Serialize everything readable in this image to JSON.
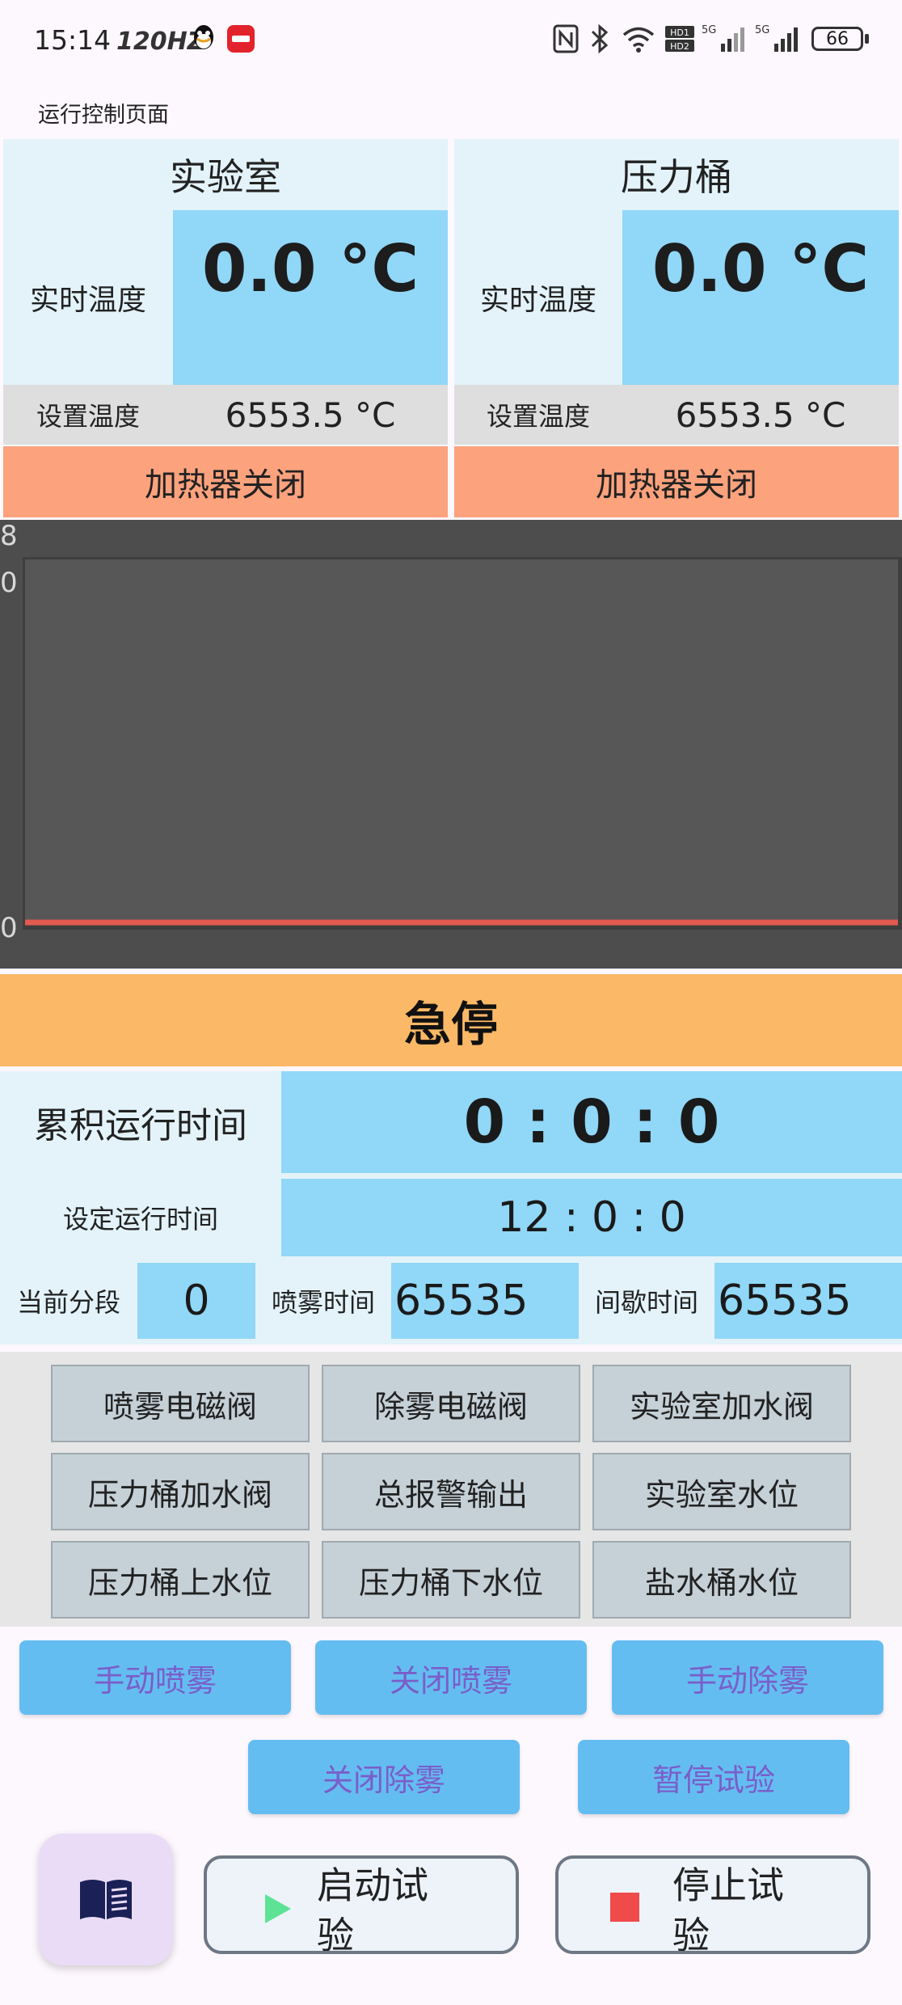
{
  "status_bar": {
    "time": "15:14",
    "hz": "120HZ",
    "battery": "66"
  },
  "page_title": "运行控制页面",
  "lab_panel": {
    "title": "实验室",
    "realtime_label": "实时温度",
    "realtime_value": "0.0 °C",
    "set_label": "设置温度",
    "set_value": "6553.5 °C",
    "heater_status": "加热器关闭"
  },
  "pressure_panel": {
    "title": "压力桶",
    "realtime_label": "实时温度",
    "realtime_value": "0.0 °C",
    "set_label": "设置温度",
    "set_value": "6553.5 °C",
    "heater_status": "加热器关闭"
  },
  "chart_data": {
    "type": "line",
    "y_tick_labels": [
      "8",
      "0",
      "0"
    ],
    "series": [
      {
        "color": "#e35a4f",
        "values": [
          0,
          0
        ]
      }
    ],
    "grid": false
  },
  "emergency_stop_label": "急停",
  "run_info": {
    "accumulated_label": "累积运行时间",
    "accumulated_value": "0 : 0 : 0",
    "set_time_label": "设定运行时间",
    "set_time_value": "12 : 0 : 0",
    "segment_label": "当前分段",
    "segment_value": "0",
    "spray_time_label": "喷雾时间",
    "spray_time_value": "65535",
    "interval_time_label": "间歇时间",
    "interval_time_value": "65535"
  },
  "io_status": [
    "喷雾电磁阀",
    "除雾电磁阀",
    "实验室加水阀",
    "压力桶加水阀",
    "总报警输出",
    "实验室水位",
    "压力桶上水位",
    "压力桶下水位",
    "盐水桶水位"
  ],
  "controls": {
    "manual_spray": "手动喷雾",
    "close_spray": "关闭喷雾",
    "manual_defog": "手动除雾",
    "close_defog": "关闭除雾",
    "pause_test": "暂停试验"
  },
  "bottom": {
    "start_line1": "启动试",
    "start_line2": "验",
    "stop_line1": "停止试",
    "stop_line2": "验"
  },
  "colors": {
    "value_blue": "#91d7f7",
    "heater_orange": "#fca27d",
    "estop_orange": "#fbb866",
    "button_blue": "#64bdf1",
    "start_green": "#5de394",
    "stop_red": "#f14a4a"
  }
}
